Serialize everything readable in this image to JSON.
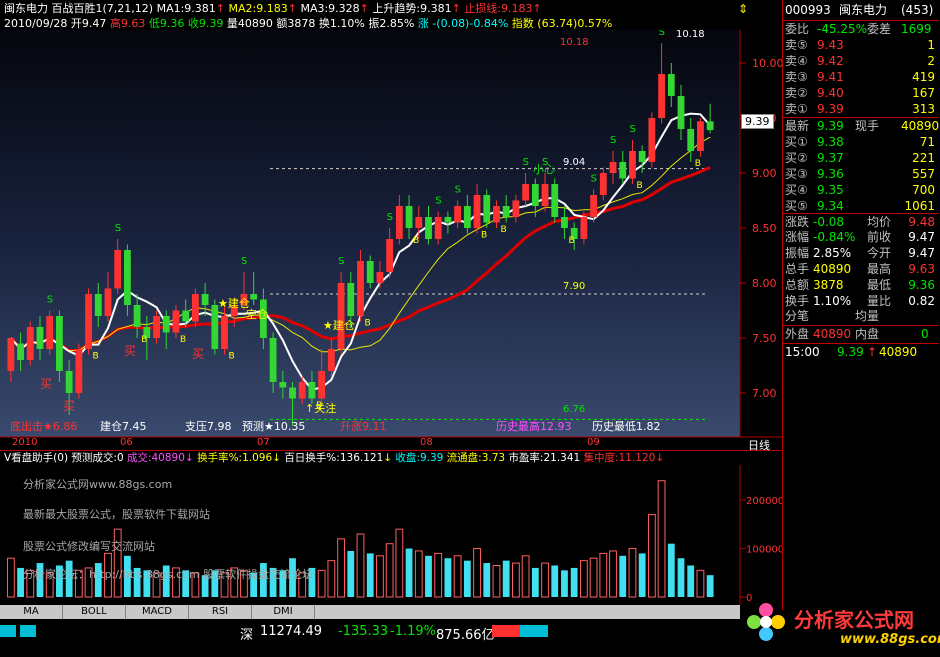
{
  "header": {
    "stock_name": "闽东电力",
    "indicator_name": "百战百胜1",
    "indicator_params": "(7,21,12)",
    "ma1": "MA1:9.381",
    "ma2": "MA2:9.183",
    "ma3": "MA3:9.328",
    "trend": "上升趋势:9.381",
    "stoploss": "止损线:9.183",
    "date": "2010/09/28",
    "open": "开9.47",
    "high": "高9.63",
    "low": "低9.36",
    "close": "收9.39",
    "volume": "量40890",
    "amount": "额3878",
    "turnover": "换1.10%",
    "amplitude": "振2.85%",
    "change": "涨 -(0.08)-0.84%",
    "index": "指数 (63.74)0.57%"
  },
  "price_axis": [
    "10.00",
    "9.50",
    "9.00",
    "8.50",
    "8.00",
    "7.50",
    "7.00"
  ],
  "current_price_tag": "9.39",
  "annotations": {
    "high_label": "10.18",
    "high_label2": "10.18",
    "level1": "9.04",
    "level2": "7.90",
    "level3": "6.76",
    "guanzhu": "关注",
    "small_heart": "小心",
    "jiancang_1": "建仓",
    "jiancang_2": "建仓",
    "kongcang": "空仓",
    "buy_marks": [
      "买",
      "买",
      "买",
      "买"
    ],
    "s_mark": "S",
    "b_mark": "B"
  },
  "bottom_info": {
    "dichu": "底出击★6.86",
    "jiancang": "建仓7.45",
    "zhiya": "支压7.98",
    "yuce": "预测★10.35",
    "shengzhang": "升涨9.11",
    "lishi_high": "历史最高12.93",
    "lishi_low": "历史最低1.82"
  },
  "time_axis": [
    "2010",
    "06",
    "07",
    "08",
    "09"
  ],
  "period": "日线",
  "vol_header": {
    "title": "V看盘助手(0)",
    "pred": "预测成交:0",
    "chengjiao": "成交:40890",
    "huanshoulv": "换手率%:1.096",
    "bairi": "百日换手%:136.121",
    "shoupan": "收盘:9.39",
    "liutong": "流通盘:3.73",
    "shiying": "市盈率:21.341",
    "jizhong": "集中度:11.120"
  },
  "vol_axis": [
    "200000",
    "100000",
    "0"
  ],
  "watermarks": [
    "分析家公式网www.88gs.com",
    "最新最大股票公式，股票软件下载网站",
    "股票公式修改编写交流网站",
    "分析家论坛：http://bbs.88gs.com 股票软件操盘交流论坛"
  ],
  "tabs": [
    "MA",
    "BOLL",
    "MACD",
    "RSI",
    "DMI"
  ],
  "status_bar": {
    "market": "深",
    "index_value": "11274.49",
    "change": "-135.33",
    "pct": "-1.19%",
    "amount": "875.66亿"
  },
  "logo": {
    "text": "分析家公式网",
    "url": "www.88gs.com"
  },
  "side": {
    "code": "000993",
    "name": "闽东电力",
    "count": "(453)",
    "weibi_label": "委比",
    "weibi": "-45.25%",
    "weicha_label": "委差",
    "weicha": "1699",
    "asks": [
      {
        "label": "卖⑤",
        "price": "9.43",
        "vol": "1"
      },
      {
        "label": "卖④",
        "price": "9.42",
        "vol": "2"
      },
      {
        "label": "卖③",
        "price": "9.41",
        "vol": "419"
      },
      {
        "label": "卖②",
        "price": "9.40",
        "vol": "167"
      },
      {
        "label": "卖①",
        "price": "9.39",
        "vol": "313"
      }
    ],
    "latest_label": "最新",
    "latest": "9.39",
    "xianshou_label": "现手",
    "xianshou": "40890",
    "bids": [
      {
        "label": "买①",
        "price": "9.38",
        "vol": "71"
      },
      {
        "label": "买②",
        "price": "9.37",
        "vol": "221"
      },
      {
        "label": "买③",
        "price": "9.36",
        "vol": "557"
      },
      {
        "label": "买④",
        "price": "9.35",
        "vol": "700"
      },
      {
        "label": "买⑤",
        "price": "9.34",
        "vol": "1061"
      }
    ],
    "stats": [
      {
        "l1": "涨跌",
        "v1": "-0.08",
        "l2": "均价",
        "v2": "9.48"
      },
      {
        "l1": "涨幅",
        "v1": "-0.84%",
        "l2": "前收",
        "v2": "9.47"
      },
      {
        "l1": "振幅",
        "v1": "2.85%",
        "l2": "今开",
        "v2": "9.47"
      },
      {
        "l1": "总手",
        "v1": "40890",
        "l2": "最高",
        "v2": "9.63"
      },
      {
        "l1": "总额",
        "v1": "3878",
        "l2": "最低",
        "v2": "9.36"
      },
      {
        "l1": "换手",
        "v1": "1.10%",
        "l2": "量比",
        "v2": "0.82"
      }
    ],
    "fenbi": "分笔",
    "junliang": "均量",
    "waipan_label": "外盘",
    "waipan": "40890",
    "neipan_label": "内盘",
    "neipan": "0",
    "tick_time": "15:00",
    "tick_price": "9.39",
    "tick_vol": "40890"
  },
  "chart_data": {
    "type": "candlestick",
    "ylim": [
      6.6,
      10.3
    ],
    "candles": [
      [
        7.2,
        7.5,
        7.1,
        7.45
      ],
      [
        7.45,
        7.3,
        7.2,
        7.55
      ],
      [
        7.3,
        7.6,
        7.25,
        7.65
      ],
      [
        7.6,
        7.4,
        7.3,
        7.7
      ],
      [
        7.4,
        7.7,
        7.35,
        7.75
      ],
      [
        7.7,
        7.2,
        7.1,
        7.75
      ],
      [
        7.2,
        7.0,
        6.8,
        7.3
      ],
      [
        7.0,
        7.4,
        6.95,
        7.45
      ],
      [
        7.4,
        7.9,
        7.35,
        7.95
      ],
      [
        7.9,
        7.7,
        7.6,
        8.0
      ],
      [
        7.7,
        7.95,
        7.65,
        8.1
      ],
      [
        7.95,
        8.3,
        7.9,
        8.4
      ],
      [
        8.3,
        7.8,
        7.7,
        8.35
      ],
      [
        7.8,
        7.6,
        7.5,
        7.9
      ],
      [
        7.6,
        7.5,
        7.3,
        7.7
      ],
      [
        7.5,
        7.7,
        7.45,
        7.75
      ],
      [
        7.7,
        7.55,
        7.4,
        7.75
      ],
      [
        7.55,
        7.75,
        7.5,
        7.8
      ],
      [
        7.75,
        7.65,
        7.6,
        7.85
      ],
      [
        7.65,
        7.9,
        7.6,
        7.95
      ],
      [
        7.9,
        7.8,
        7.7,
        8.0
      ],
      [
        7.8,
        7.4,
        7.35,
        7.85
      ],
      [
        7.4,
        7.7,
        7.35,
        7.8
      ],
      [
        7.7,
        7.8,
        7.6,
        7.85
      ],
      [
        7.8,
        7.9,
        7.75,
        8.1
      ],
      [
        7.9,
        7.85,
        7.8,
        8.1
      ],
      [
        7.85,
        7.5,
        7.4,
        7.95
      ],
      [
        7.5,
        7.1,
        7.0,
        7.55
      ],
      [
        7.1,
        7.05,
        6.95,
        7.2
      ],
      [
        7.05,
        6.95,
        6.7,
        7.1
      ],
      [
        6.95,
        7.1,
        6.9,
        7.15
      ],
      [
        7.1,
        6.95,
        6.9,
        7.2
      ],
      [
        6.95,
        7.2,
        6.9,
        7.4
      ],
      [
        7.2,
        7.4,
        7.15,
        7.5
      ],
      [
        7.4,
        8.0,
        7.35,
        8.1
      ],
      [
        8.0,
        7.7,
        7.6,
        8.1
      ],
      [
        7.7,
        8.2,
        7.65,
        8.3
      ],
      [
        8.2,
        8.0,
        7.95,
        8.25
      ],
      [
        8.0,
        8.1,
        7.95,
        8.2
      ],
      [
        8.1,
        8.4,
        8.05,
        8.5
      ],
      [
        8.4,
        8.7,
        8.35,
        8.8
      ],
      [
        8.7,
        8.5,
        8.4,
        8.8
      ],
      [
        8.5,
        8.6,
        8.4,
        8.7
      ],
      [
        8.6,
        8.4,
        8.35,
        8.7
      ],
      [
        8.4,
        8.6,
        8.35,
        8.65
      ],
      [
        8.6,
        8.55,
        8.45,
        8.65
      ],
      [
        8.55,
        8.7,
        8.5,
        8.75
      ],
      [
        8.7,
        8.5,
        8.45,
        8.8
      ],
      [
        8.5,
        8.8,
        8.45,
        8.9
      ],
      [
        8.8,
        8.55,
        8.5,
        8.85
      ],
      [
        8.55,
        8.7,
        8.5,
        8.75
      ],
      [
        8.7,
        8.6,
        8.55,
        8.8
      ],
      [
        8.6,
        8.75,
        8.55,
        8.8
      ],
      [
        8.75,
        8.9,
        8.7,
        9.0
      ],
      [
        8.9,
        8.7,
        8.6,
        8.95
      ],
      [
        8.7,
        8.9,
        8.65,
        9.0
      ],
      [
        8.9,
        8.6,
        8.55,
        8.95
      ],
      [
        8.6,
        8.5,
        8.4,
        8.7
      ],
      [
        8.5,
        8.4,
        8.3,
        8.55
      ],
      [
        8.4,
        8.6,
        8.35,
        8.65
      ],
      [
        8.6,
        8.8,
        8.55,
        8.85
      ],
      [
        8.8,
        9.0,
        8.75,
        9.05
      ],
      [
        9.0,
        9.1,
        8.9,
        9.2
      ],
      [
        9.1,
        8.95,
        8.9,
        9.2
      ],
      [
        8.95,
        9.2,
        8.9,
        9.3
      ],
      [
        9.2,
        9.1,
        9.0,
        9.25
      ],
      [
        9.1,
        9.5,
        9.05,
        9.55
      ],
      [
        9.5,
        9.9,
        9.45,
        10.18
      ],
      [
        9.9,
        9.7,
        9.6,
        10.0
      ],
      [
        9.7,
        9.4,
        9.3,
        9.8
      ],
      [
        9.4,
        9.2,
        9.1,
        9.5
      ],
      [
        9.2,
        9.47,
        9.15,
        9.5
      ],
      [
        9.47,
        9.39,
        9.36,
        9.63
      ]
    ],
    "volumes": [
      80000,
      60000,
      55000,
      70000,
      50000,
      65000,
      75000,
      55000,
      60000,
      70000,
      90000,
      140000,
      85000,
      60000,
      55000,
      50000,
      65000,
      60000,
      55000,
      50000,
      45000,
      55000,
      50000,
      60000,
      55000,
      50000,
      70000,
      60000,
      55000,
      80000,
      50000,
      60000,
      55000,
      75000,
      120000,
      95000,
      130000,
      90000,
      85000,
      110000,
      140000,
      100000,
      95000,
      85000,
      90000,
      80000,
      85000,
      75000,
      100000,
      70000,
      65000,
      75000,
      70000,
      85000,
      60000,
      70000,
      65000,
      55000,
      60000,
      75000,
      80000,
      90000,
      95000,
      85000,
      100000,
      90000,
      170000,
      240000,
      110000,
      80000,
      65000,
      55000,
      45000
    ]
  }
}
